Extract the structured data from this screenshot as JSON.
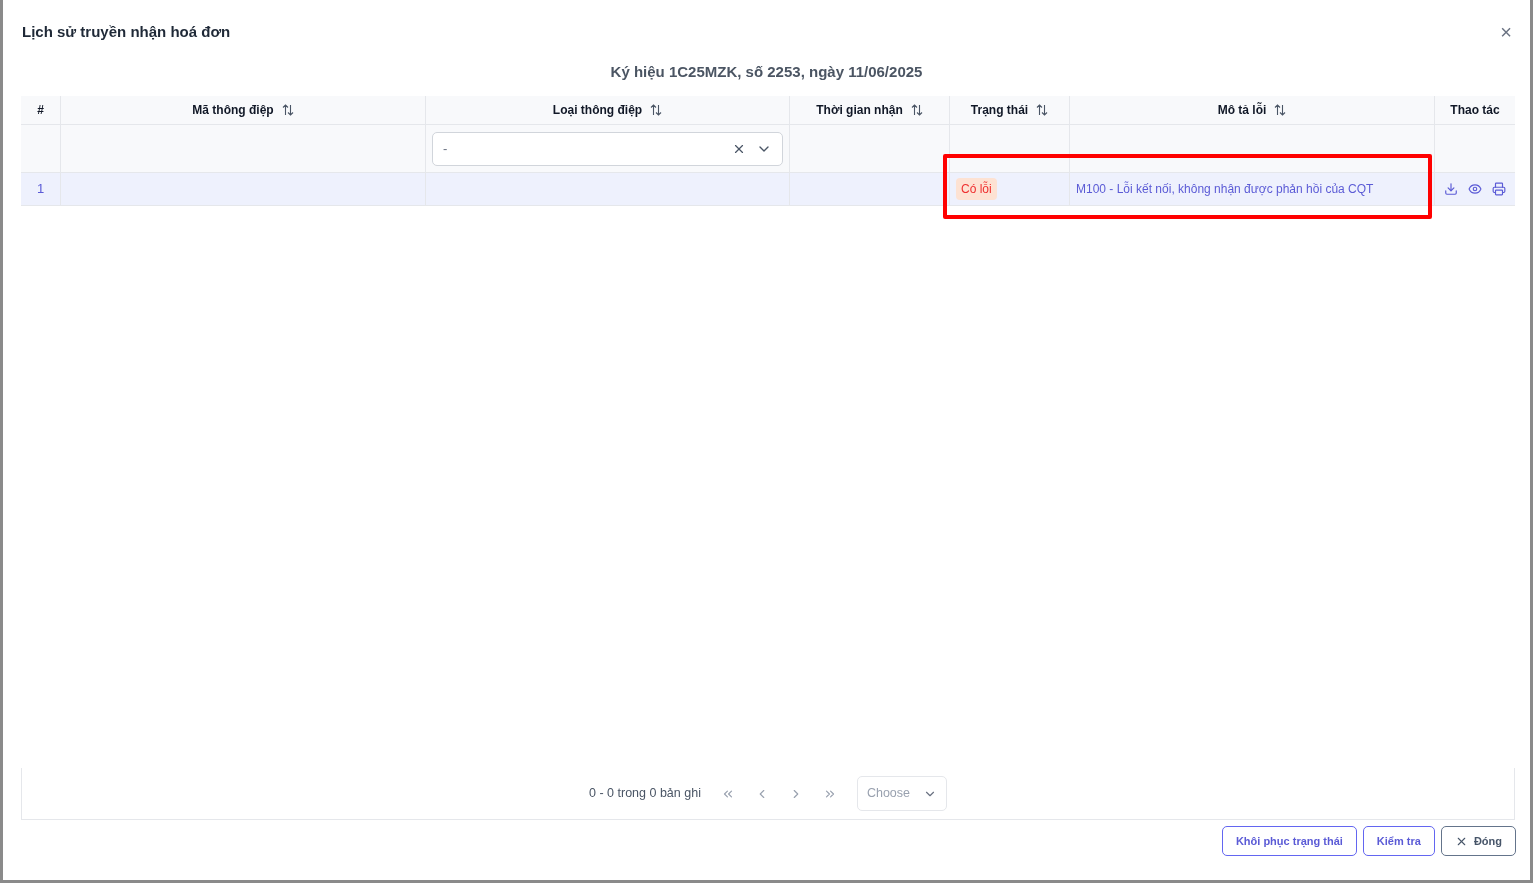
{
  "dialog": {
    "title": "Lịch sử truyền nhận hoá đơn",
    "close_symbol": "×"
  },
  "subtitle": "Ký hiệu 1C25MZK, số 2253, ngày 11/06/2025",
  "table": {
    "columns": [
      {
        "label": "#",
        "sortable": false
      },
      {
        "label": "Mã thông điệp",
        "sortable": true
      },
      {
        "label": "Loại thông điệp",
        "sortable": true
      },
      {
        "label": "Thời gian nhận",
        "sortable": true
      },
      {
        "label": "Trạng thái",
        "sortable": true
      },
      {
        "label": "Mô tả lỗi",
        "sortable": true
      },
      {
        "label": "Thao tác",
        "sortable": false
      }
    ],
    "filter": {
      "value": "-"
    },
    "rows": [
      {
        "index": "1",
        "message_code": "",
        "message_type": "",
        "received_time": "",
        "status": "Có lỗi",
        "error": "M100 - Lỗi kết nối, không nhận được phản hồi của CQT",
        "highlighted": true
      }
    ]
  },
  "pagination": {
    "summary": "0 - 0 trong 0 bản ghi",
    "page_size_placeholder": "Choose"
  },
  "buttons": [
    {
      "label": "Khôi phục trạng thái",
      "kind": "primary"
    },
    {
      "label": "Kiểm tra",
      "kind": "primary"
    },
    {
      "label": "Đóng",
      "kind": "close"
    }
  ]
}
